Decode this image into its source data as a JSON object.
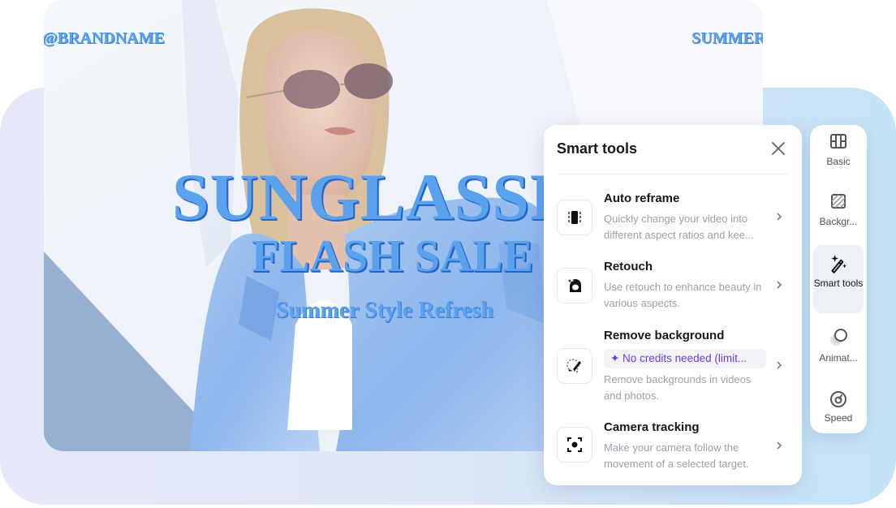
{
  "preview": {
    "overlay_brand": "@BRANDNAME",
    "overlay_corner": "SUMMER",
    "overlay_title": "SUNGLASSES",
    "overlay_subtitle": "FLASH SALE",
    "overlay_tagline": "Summer Style Refresh"
  },
  "panel": {
    "title": "Smart tools",
    "close_icon": "close-icon",
    "tools": [
      {
        "name": "Auto reframe",
        "desc": "Quickly change your video into different aspect ratios and kee...",
        "icon": "auto-reframe-icon"
      },
      {
        "name": "Retouch",
        "desc": "Use retouch to enhance beauty in various aspects.",
        "icon": "retouch-icon"
      },
      {
        "name": "Remove background",
        "badge": "✦ No credits needed (limit...",
        "desc": "Remove backgrounds in videos and photos.",
        "icon": "remove-background-icon"
      },
      {
        "name": "Camera tracking",
        "desc": "Make your camera follow the movement of a selected target.",
        "icon": "camera-tracking-icon"
      }
    ]
  },
  "rail": {
    "items": [
      {
        "label": "Basic",
        "icon": "film-icon"
      },
      {
        "label": "Backgr...",
        "icon": "background-icon"
      },
      {
        "label": "Smart tools",
        "icon": "magic-wand-icon",
        "active": true
      },
      {
        "label": "Animat...",
        "icon": "animation-icon"
      },
      {
        "label": "Speed",
        "icon": "speed-icon"
      }
    ]
  },
  "colors": {
    "overlay_text": "#5aa2ee",
    "badge_text": "#6a3fe0",
    "active_rail_bg": "#edf0f4"
  }
}
